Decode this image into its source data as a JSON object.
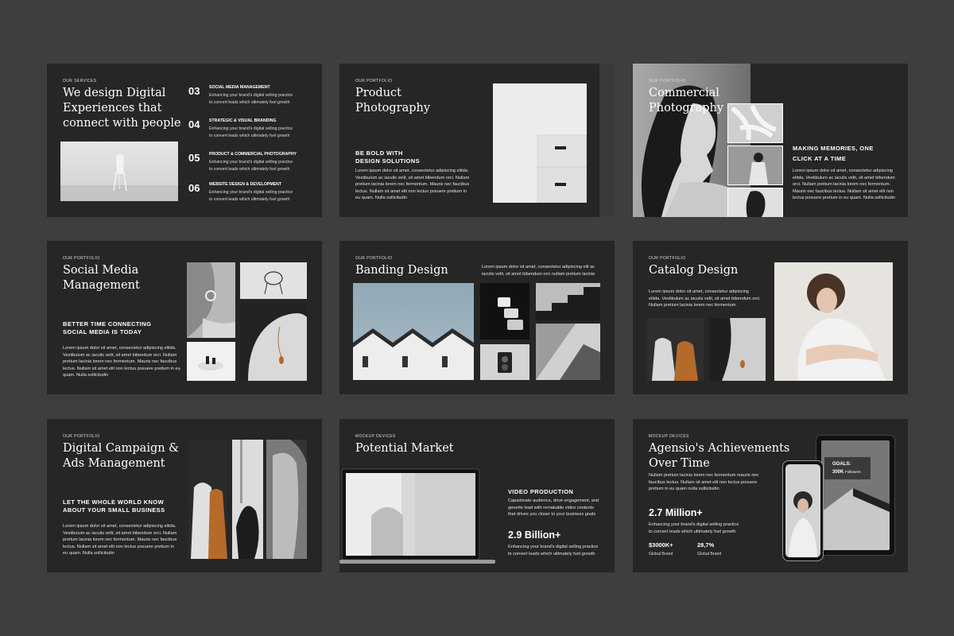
{
  "slides": {
    "services": {
      "kicker": "OUR SERVICES",
      "title_lines": [
        "We design Digital",
        "Experiences that",
        "connect with people"
      ],
      "items": [
        {
          "num": "03",
          "title": "SOCIAL MEDIA MANAGEMENT",
          "desc": [
            "Enhancing your brand's digital selling practice",
            "to convert leads which ultimately fuel growth"
          ]
        },
        {
          "num": "04",
          "title": "STRATEGIC & VISUAL BRANDING",
          "desc": [
            "Enhancing your brand's digital selling practice",
            "to convert leads which ultimately fuel growth"
          ]
        },
        {
          "num": "05",
          "title": "PRODUCT & COMMERCIAL PHOTOGRAPHY",
          "desc": [
            "Enhancing your brand's digital selling practice",
            "to convert leads which ultimately fuel growth"
          ]
        },
        {
          "num": "06",
          "title": "WEBSITE DESIGN & DEVELOPMENT",
          "desc": [
            "Enhancing your brand's digital selling practice",
            "to convert leads which ultimately fuel growth"
          ]
        }
      ]
    },
    "product": {
      "kicker": "OUR PORTFOLIO",
      "title_lines": [
        "Product",
        "Photography"
      ],
      "sub_lines": [
        "BE BOLD WITH",
        "DESIGN SOLUTIONS"
      ],
      "body_lines": [
        "Lorem ipsum dolor sit amet, consectetur adipiscing elitda.",
        "Vestibulum ac iaculis velit, sit amet bibendum orci. Nullam",
        "pretium lacinia lorem nec fermentum. Mauris nec faucibus",
        "lectus. Nullam sit amet elit non lectus posuere pretium in",
        "eu quam. Nulla sollicitudin"
      ]
    },
    "commercial": {
      "kicker": "OUR PORTFOLIO",
      "title_lines": [
        "Commercial",
        "Photography"
      ],
      "sub_lines": [
        "MAKING MEMORIES, ONE",
        "CLICK AT A TIME"
      ],
      "body_lines": [
        "Lorem ipsum dolor sit amet, consectetur adipiscing",
        "elitda. Vestibulum ac iaculis velit, sit amet bibendum",
        "orci. Nullam pretium lacinia lorem nec fermentum.",
        "Mauris nec faucibus lectus. Nullam sit amet elit non",
        "lectus posuere pretium in eu quam. Nulla sollicitudin"
      ]
    },
    "social": {
      "kicker": "OUR PORTFOLIO",
      "title_lines": [
        "Social Media",
        "Management"
      ],
      "sub_lines": [
        "BETTER TIME CONNECTING",
        "SOCIAL MEDIA IS TODAY"
      ],
      "body_lines": [
        "Lorem ipsum dolor sit amet, consectetur adipiscing elitda.",
        "Vestibulum ac iaculis velit, sit amet bibendum orci. Nullam",
        "pretium lacinia lorem nec fermentum. Mauris nec faucibus",
        "lectus. Nullam sit amet elit non lectus posuere pretium in eu",
        "quam. Nulla sollicitudin"
      ]
    },
    "banding": {
      "kicker": "OUR PORTFOLIO",
      "title_lines": [
        "Banding Design"
      ],
      "body_lines": [
        "Lorem ipsum dolor sit amet, consectetur adipiscing elit ac",
        "iaculis velit, sit amet bibendum orci nullam pretium lacinia"
      ]
    },
    "catalog": {
      "kicker": "OUR PORTFOLIO",
      "title_lines": [
        "Catalog Design"
      ],
      "body_lines": [
        "Lorem ipsum dolor sit amet, consectetur adipiscing",
        "elitda. Vestibulum ac iaculis velit, sit amet bibendum orci.",
        "Nullam pretium lacinia lorem nec fermentum."
      ]
    },
    "campaign": {
      "kicker": "OUR PORTFOLIO",
      "title_lines": [
        "Digital Campaign &",
        "Ads Management"
      ],
      "sub_lines": [
        "LET THE WHOLE WORLD KNOW",
        "ABOUT YOUR SMALL BUSINESS"
      ],
      "body_lines": [
        "Lorem ipsum dolor sit amet, consectetur adipiscing elitda.",
        "Vestibulum ac iaculis velit, sit amet bibendum orci. Nullam",
        "pretium lacinia lorem nec fermentum. Mauris nec faucibus",
        "lectus. Nullam sit amet elit non lectus posuere pretium in",
        "eu quam. Nulla sollicitudin"
      ]
    },
    "market": {
      "kicker": "MOCKUP DEVICES",
      "title_lines": [
        "Potential Market"
      ],
      "sub_lines": [
        "VIDEO PRODUCTION"
      ],
      "body_lines": [
        "Capastivate audience, drive engagement, and",
        "generte lead with remakable video contents",
        "that drives you closer to your business goals"
      ],
      "big": "2.9 Billion+",
      "big_desc": [
        "Enhancing your brand's digital selling practice",
        "to convert leads which ultimately fuel growth"
      ]
    },
    "achievements": {
      "kicker": "MOCKUP DEVICES",
      "title_lines": [
        "Agensio's Achievements",
        "Over Time"
      ],
      "body_lines": [
        "Nullam pretium lacinia lorem nec fermentum mauris nec",
        "faucibus lectus. Nullam sit amet elit non lectus posuere",
        "pretium in eu quam nulla sollicitudin"
      ],
      "big": "2.7 Million+",
      "big_desc": [
        "Enhancing your brand's digital selling practice",
        "to convert leads which ultimately fuel growth"
      ],
      "stats": [
        {
          "value": "$3000K+",
          "label": "Global Brand"
        },
        {
          "value": "28,7%",
          "label": "Global Brand"
        }
      ],
      "goals_label": "GOALS:",
      "goals_value": "300K",
      "goals_unit": "Followers"
    }
  }
}
